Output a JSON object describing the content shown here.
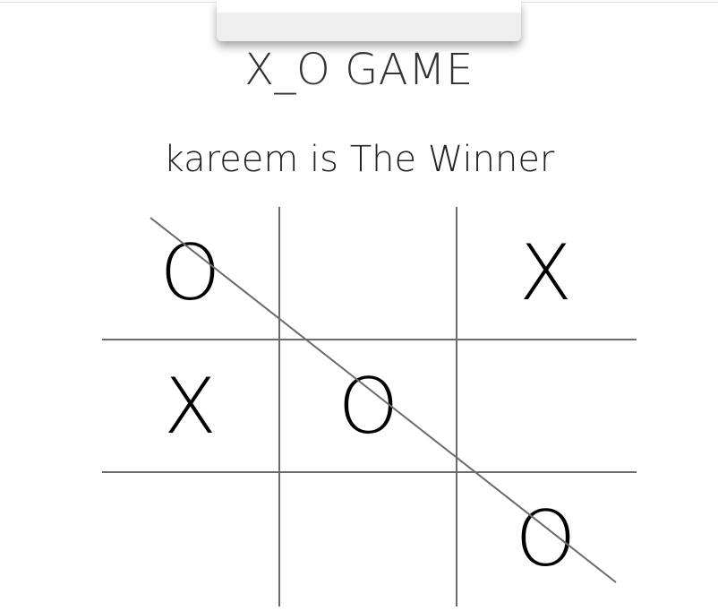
{
  "game": {
    "title": "X_O GAME",
    "status": "kareem is The Winner"
  },
  "board": {
    "cells": [
      "O",
      "",
      "X",
      "X",
      "O",
      "",
      "",
      "",
      "O"
    ],
    "winning_line": "diagonal-top-left-to-bottom-right"
  },
  "colors": {
    "grid": "#6b6b6b",
    "marks": "#000000",
    "strike": "#6b6b6b"
  }
}
